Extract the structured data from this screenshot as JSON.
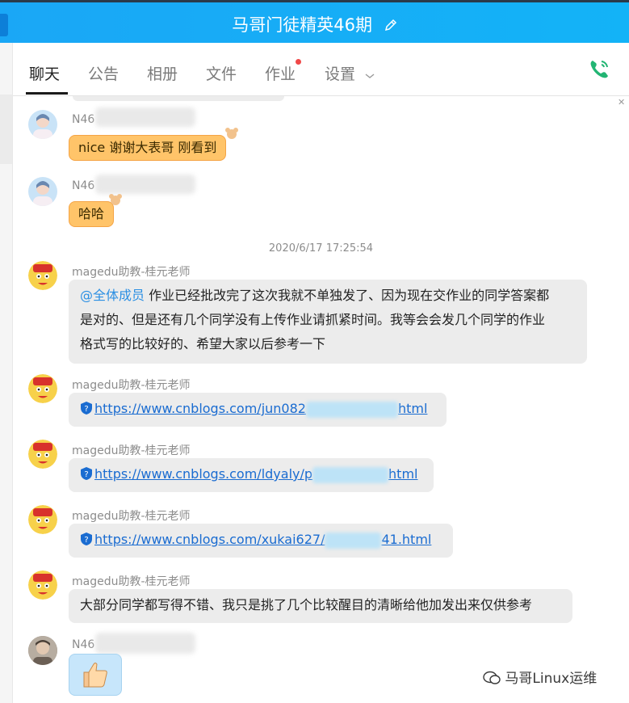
{
  "header": {
    "title": "马哥门徒精英46期"
  },
  "tabs": [
    {
      "label": "聊天",
      "active": true
    },
    {
      "label": "公告"
    },
    {
      "label": "相册"
    },
    {
      "label": "文件"
    },
    {
      "label": "作业",
      "has_dot": true
    },
    {
      "label": "设置"
    }
  ],
  "messages": [
    {
      "name": "N46",
      "text": "nice 谢谢大表哥 刚看到"
    },
    {
      "name": "N46",
      "text": "哈哈"
    },
    {
      "timestamp": "2020/6/17 17:25:54"
    },
    {
      "name": "magedu助教-桂元老师",
      "mention": "@全体成员",
      "text_line1": "作业已经批改完了这次我就不单独发了、因为现在交作业的同学答案都",
      "text_line2": "是对的、但是还有几个同学没有上传作业请抓紧时间。我等会会发几个同学的作业",
      "text_line3": "格式写的比较好的、希望大家以后参考一下"
    },
    {
      "name": "magedu助教-桂元老师",
      "link_start": "https://www.cnblogs.com/jun082",
      "link_end": "html"
    },
    {
      "name": "magedu助教-桂元老师",
      "link_start": "https://www.cnblogs.com/ldyaly/p",
      "link_end": "html"
    },
    {
      "name": "magedu助教-桂元老师",
      "link_start": "https://www.cnblogs.com/xukai627/",
      "link_end": "41.html"
    },
    {
      "name": "magedu助教-桂元老师",
      "text": "大部分同学都写得不错、我只是挑了几个比较醒目的清晰给他加发出来仅供参考"
    },
    {
      "name": "N46",
      "emoji": "thumbs-up"
    }
  ],
  "watermark": "马哥Linux运维",
  "colors": {
    "header": "#1aa7f6",
    "link": "#1a6cd1",
    "bubble_gray": "#ececec",
    "bubble_orange": "#ffc469",
    "phone_icon": "#22b573"
  }
}
